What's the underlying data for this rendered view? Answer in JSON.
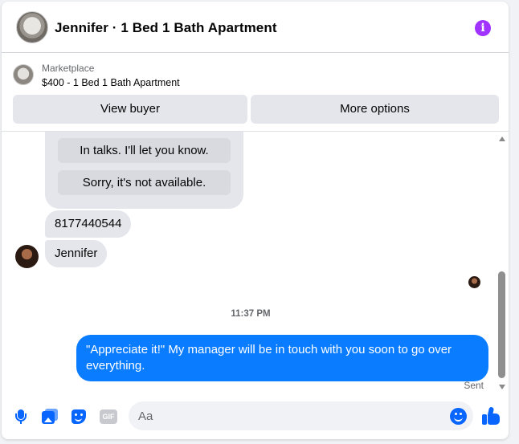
{
  "header": {
    "title": "Jennifer · 1 Bed 1 Bath Apartment",
    "info_icon": "info-icon",
    "accent": "#a033ff"
  },
  "listing": {
    "category": "Marketplace",
    "summary": "$400 - 1 Bed 1 Bath Apartment",
    "buttons": {
      "view_buyer": "View buyer",
      "more_options": "More options"
    }
  },
  "thread": {
    "quick_replies": [
      "In talks. I'll let you know.",
      "Sorry, it's not available."
    ],
    "incoming": [
      {
        "text": "8177440544"
      },
      {
        "text": "Jennifer"
      }
    ],
    "timestamp": "11:37 PM",
    "outgoing": {
      "text": "\"Appreciate it!\" My manager will be in touch with you soon to go over everything.",
      "status": "Sent"
    },
    "colors": {
      "outgoing_bubble": "#0a7cff",
      "incoming_bubble": "#e4e6eb"
    }
  },
  "composer": {
    "placeholder": "Aa",
    "gif_label": "GIF",
    "icons": [
      "microphone-icon",
      "photo-icon",
      "sticker-icon",
      "gif-icon",
      "emoji-icon",
      "thumbs-up-icon"
    ],
    "accent": "#0866ff"
  }
}
